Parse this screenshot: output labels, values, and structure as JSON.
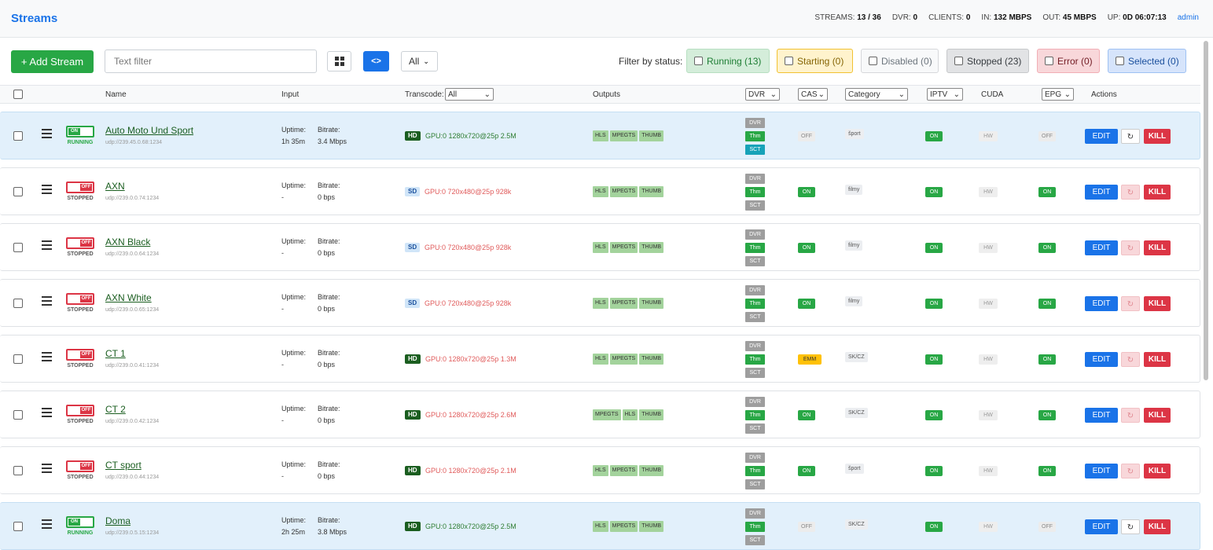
{
  "app": {
    "title": "Streams",
    "user": "admin"
  },
  "stats": [
    {
      "label": "STREAMS:",
      "value": "13 / 36"
    },
    {
      "label": "DVR:",
      "value": "0"
    },
    {
      "label": "CLIENTS:",
      "value": "0"
    },
    {
      "label": "IN:",
      "value": "132 MBPS"
    },
    {
      "label": "OUT:",
      "value": "45 MBPS"
    },
    {
      "label": "UP:",
      "value": "0D 06:07:13"
    }
  ],
  "toolbar": {
    "add_label": "+ Add Stream",
    "filter_placeholder": "Text filter",
    "list_view_glyph": "<>",
    "view_select": "All",
    "filter_label": "Filter by status:",
    "status_filters": [
      {
        "label": "Running (13)",
        "key": "running"
      },
      {
        "label": "Starting (0)",
        "key": "starting"
      },
      {
        "label": "Disabled (0)",
        "key": "disabled"
      },
      {
        "label": "Stopped (23)",
        "key": "stopped"
      },
      {
        "label": "Error (0)",
        "key": "error"
      },
      {
        "label": "Selected (0)",
        "key": "selected"
      }
    ]
  },
  "columns": {
    "name": "Name",
    "input": "Input",
    "transcode": "Transcode:",
    "transcode_select": "All",
    "outputs": "Outputs",
    "dvr": "DVR",
    "cas": "CAS",
    "category": "Category",
    "iptv": "IPTV",
    "cuda": "CUDA",
    "epg": "EPG",
    "actions": "Actions"
  },
  "labels": {
    "uptime": "Uptime:",
    "bitrate": "Bitrate:",
    "on": "ON",
    "off": "OFF",
    "running": "RUNNING",
    "stopped": "STOPPED",
    "dvr": "DVR",
    "thm": "Thm",
    "sct": "SCT",
    "hw": "HW",
    "edit": "EDIT",
    "kill": "KILL",
    "restart": "↻"
  },
  "streams": [
    {
      "name": "Auto Moto Und Sport",
      "url": "udp://239.45.0.68:1234",
      "running": true,
      "uptime": "1h 35m",
      "bitrate": "3.4 Mbps",
      "res": "HD",
      "transcode": "GPU:0 1280x720@25p 2.5M",
      "outputs": [
        "HLS",
        "MPEGTS",
        "THUMB"
      ],
      "cas": "OFF",
      "category": "šport",
      "iptv": "ON",
      "cuda": "HW",
      "epg": "OFF"
    },
    {
      "name": "AXN",
      "url": "udp://239.0.0.74:1234",
      "running": false,
      "uptime": "-",
      "bitrate": "0 bps",
      "res": "SD",
      "transcode": "GPU:0 720x480@25p 928k",
      "outputs": [
        "HLS",
        "MPEGTS",
        "THUMB"
      ],
      "cas": "ON",
      "category": "filmy",
      "iptv": "ON",
      "cuda": "HW",
      "epg": "ON"
    },
    {
      "name": "AXN Black",
      "url": "udp://239.0.0.64:1234",
      "running": false,
      "uptime": "-",
      "bitrate": "0 bps",
      "res": "SD",
      "transcode": "GPU:0 720x480@25p 928k",
      "outputs": [
        "HLS",
        "MPEGTS",
        "THUMB"
      ],
      "cas": "ON",
      "category": "filmy",
      "iptv": "ON",
      "cuda": "HW",
      "epg": "ON"
    },
    {
      "name": "AXN White",
      "url": "udp://239.0.0.65:1234",
      "running": false,
      "uptime": "-",
      "bitrate": "0 bps",
      "res": "SD",
      "transcode": "GPU:0 720x480@25p 928k",
      "outputs": [
        "HLS",
        "MPEGTS",
        "THUMB"
      ],
      "cas": "ON",
      "category": "filmy",
      "iptv": "ON",
      "cuda": "HW",
      "epg": "ON"
    },
    {
      "name": "CT 1",
      "url": "udp://239.0.0.41:1234",
      "running": false,
      "uptime": "-",
      "bitrate": "0 bps",
      "res": "HD",
      "transcode": "GPU:0 1280x720@25p 1.3M",
      "outputs": [
        "HLS",
        "MPEGTS",
        "THUMB"
      ],
      "cas": "EMM",
      "category": "SK/CZ",
      "iptv": "ON",
      "cuda": "HW",
      "epg": "ON"
    },
    {
      "name": "CT 2",
      "url": "udp://239.0.0.42:1234",
      "running": false,
      "uptime": "-",
      "bitrate": "0 bps",
      "res": "HD",
      "transcode": "GPU:0 1280x720@25p 2.6M",
      "outputs": [
        "MPEGTS",
        "HLS",
        "THUMB"
      ],
      "cas": "ON",
      "category": "SK/CZ",
      "iptv": "ON",
      "cuda": "HW",
      "epg": "ON"
    },
    {
      "name": "CT sport",
      "url": "udp://239.0.0.44:1234",
      "running": false,
      "uptime": "-",
      "bitrate": "0 bps",
      "res": "HD",
      "transcode": "GPU:0 1280x720@25p 2.1M",
      "outputs": [
        "HLS",
        "MPEGTS",
        "THUMB"
      ],
      "cas": "ON",
      "category": "šport",
      "iptv": "ON",
      "cuda": "HW",
      "epg": "ON"
    },
    {
      "name": "Doma",
      "url": "udp://239.0.5.15:1234",
      "running": true,
      "uptime": "2h 25m",
      "bitrate": "3.8 Mbps",
      "res": "HD",
      "transcode": "GPU:0 1280x720@25p 2.5M",
      "outputs": [
        "HLS",
        "MPEGTS",
        "THUMB"
      ],
      "cas": "OFF",
      "category": "SK/CZ",
      "iptv": "ON",
      "cuda": "HW",
      "epg": "OFF"
    }
  ],
  "colors": {
    "accent": "#1a73e8",
    "success": "#28a745",
    "danger": "#dc3545",
    "warning": "#ffc107"
  }
}
